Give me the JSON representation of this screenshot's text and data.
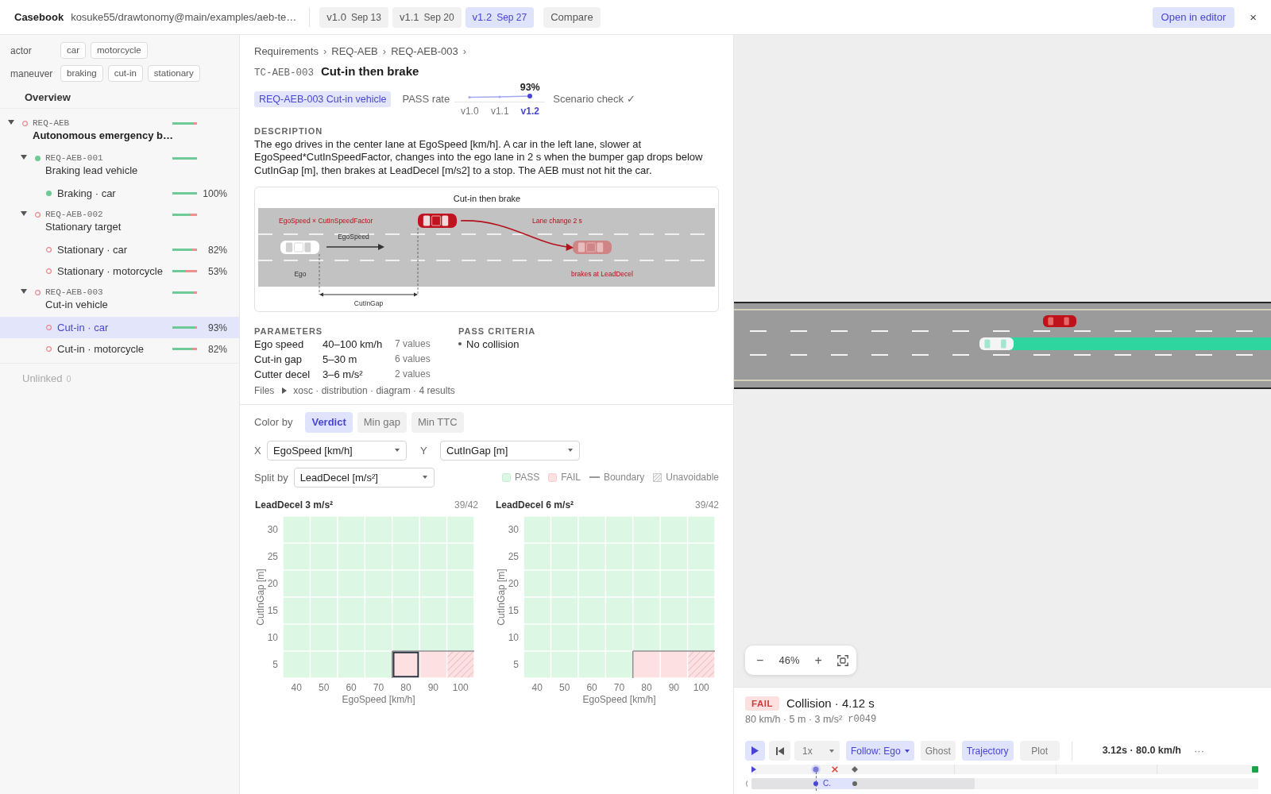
{
  "topbar": {
    "app_name": "Casebook",
    "path": "kosuke55/drawtonomy@main/examples/aeb-te…",
    "versions": [
      {
        "version": "v1.0",
        "date": "Sep 13",
        "selected": false
      },
      {
        "version": "v1.1",
        "date": "Sep 20",
        "selected": false
      },
      {
        "version": "v1.2",
        "date": "Sep 27",
        "selected": true
      }
    ],
    "compare": "Compare",
    "open_editor": "Open in editor",
    "close": "×"
  },
  "filters": [
    {
      "label": "actor",
      "chips": [
        "car",
        "motorcycle"
      ]
    },
    {
      "label": "maneuver",
      "chips": [
        "braking",
        "cut-in",
        "stationary"
      ]
    }
  ],
  "overview": "Overview",
  "tree": [
    {
      "id": "REQ-AEB",
      "title": "Autonomous emergency b…",
      "passed": false,
      "level": 0.88,
      "expanded": true,
      "selected": false,
      "children": [
        {
          "id": "REQ-AEB-001",
          "title": "Braking lead vehicle",
          "passed": true,
          "level": 1,
          "expanded": true,
          "selected": false,
          "children": [
            {
              "label": "Braking · car",
              "passed": true,
              "level": 1,
              "percent": "100%",
              "selected": false
            }
          ]
        },
        {
          "id": "REQ-AEB-002",
          "title": "Stationary target",
          "passed": false,
          "level": 0.7,
          "expanded": true,
          "selected": false,
          "children": [
            {
              "label": "Stationary · car",
              "passed": false,
              "level": 0.81,
              "percent": "82%",
              "selected": false
            },
            {
              "label": "Stationary · motorcycle",
              "passed": false,
              "level": 0.53,
              "percent": "53%",
              "selected": false
            }
          ]
        },
        {
          "id": "REQ-AEB-003",
          "title": "Cut-in vehicle",
          "passed": false,
          "level": 0.88,
          "expanded": true,
          "selected": false,
          "children": [
            {
              "label": "Cut-in · car",
              "passed": false,
              "level": 0.92,
              "percent": "93%",
              "selected": true
            },
            {
              "label": "Cut-in · motorcycle",
              "passed": false,
              "level": 0.81,
              "percent": "82%",
              "selected": false
            }
          ]
        }
      ]
    }
  ],
  "unlinked": {
    "label": "Unlinked",
    "count": "0"
  },
  "breadcrumb": [
    {
      "label": "Requirements",
      "separator": "›"
    },
    {
      "label": "REQ-AEB",
      "separator": "›"
    },
    {
      "label": "REQ-AEB-003",
      "separator": "›"
    }
  ],
  "case": {
    "id": "TC-AEB-003",
    "title": "Cut-in then brake"
  },
  "requirement_tag": "REQ-AEB-003 Cut-in vehicle",
  "pass_rate": {
    "label": "PASS rate",
    "value": "93%",
    "versions": [
      {
        "label": "v1.0",
        "selected": false
      },
      {
        "label": "v1.1",
        "selected": false
      },
      {
        "label": "v1.2",
        "selected": true
      }
    ]
  },
  "scenario_check": "Scenario check ✓",
  "description": {
    "heading": "DESCRIPTION",
    "text": "The ego drives in the center lane at EgoSpeed [km/h]. A car in the left lane, slower at EgoSpeed*CutInSpeedFactor, changes into the ego lane in 2 s when the bumper gap drops below CutInGap [m], then brakes at LeadDecel [m/s2] to a stop. The AEB must not hit the car."
  },
  "diagram": {
    "title": "Cut-in then brake",
    "labels": {
      "cutter_speed": "EgoSpeed × CutInSpeedFactor",
      "ego_speed": "EgoSpeed",
      "lane_change": "Lane change 2 s",
      "ego": "Ego",
      "brake": "brakes at LeadDecel",
      "gap": "CutInGap"
    }
  },
  "parameters": {
    "heading": "PARAMETERS",
    "rows": [
      {
        "name": "Ego speed",
        "range": "40–100 km/h",
        "count": "7 values"
      },
      {
        "name": "Cut-in gap",
        "range": "5–30 m",
        "count": "6 values"
      },
      {
        "name": "Cutter decel",
        "range": "3–6 m/s²",
        "count": "2 values"
      }
    ]
  },
  "pass_criteria": {
    "heading": "PASS CRITERIA",
    "items": [
      "No collision"
    ]
  },
  "files": {
    "label": "Files",
    "expanded": false,
    "summary": "xosc · distribution · diagram · 4 results"
  },
  "color_by": {
    "label": "Color by",
    "options": [
      {
        "label": "Verdict",
        "selected": true
      },
      {
        "label": "Min gap",
        "selected": false
      },
      {
        "label": "Min TTC",
        "selected": false
      }
    ]
  },
  "axes": {
    "x": {
      "label": "X",
      "value": "EgoSpeed [km/h]"
    },
    "y": {
      "label": "Y",
      "value": "CutInGap [m]"
    },
    "split": {
      "label": "Split by",
      "value": "LeadDecel [m/s²]"
    }
  },
  "legend": [
    {
      "kind": "pass",
      "label": "PASS"
    },
    {
      "kind": "fail",
      "label": "FAIL"
    },
    {
      "kind": "boundary",
      "label": "Boundary"
    },
    {
      "kind": "unavoidable",
      "label": "Unavoidable"
    }
  ],
  "panels": [
    {
      "title": "LeadDecel 3 m/s²",
      "count": "39/42",
      "y_label": "CutInGap [m]",
      "x_label": "EgoSpeed [km/h]",
      "x_ticks": [
        "40",
        "50",
        "60",
        "70",
        "80",
        "90",
        "100"
      ],
      "rows": [
        {
          "tick": "30",
          "cells": [
            {
              "kind": "pass",
              "selected": false
            },
            {
              "kind": "pass",
              "selected": false
            },
            {
              "kind": "pass",
              "selected": false
            },
            {
              "kind": "pass",
              "selected": false
            },
            {
              "kind": "pass",
              "selected": false
            },
            {
              "kind": "pass",
              "selected": false
            },
            {
              "kind": "pass",
              "selected": false
            }
          ]
        },
        {
          "tick": "25",
          "cells": [
            {
              "kind": "pass",
              "selected": false
            },
            {
              "kind": "pass",
              "selected": false
            },
            {
              "kind": "pass",
              "selected": false
            },
            {
              "kind": "pass",
              "selected": false
            },
            {
              "kind": "pass",
              "selected": false
            },
            {
              "kind": "pass",
              "selected": false
            },
            {
              "kind": "pass",
              "selected": false
            }
          ]
        },
        {
          "tick": "20",
          "cells": [
            {
              "kind": "pass",
              "selected": false
            },
            {
              "kind": "pass",
              "selected": false
            },
            {
              "kind": "pass",
              "selected": false
            },
            {
              "kind": "pass",
              "selected": false
            },
            {
              "kind": "pass",
              "selected": false
            },
            {
              "kind": "pass",
              "selected": false
            },
            {
              "kind": "pass",
              "selected": false
            }
          ]
        },
        {
          "tick": "15",
          "cells": [
            {
              "kind": "pass",
              "selected": false
            },
            {
              "kind": "pass",
              "selected": false
            },
            {
              "kind": "pass",
              "selected": false
            },
            {
              "kind": "pass",
              "selected": false
            },
            {
              "kind": "pass",
              "selected": false
            },
            {
              "kind": "pass",
              "selected": false
            },
            {
              "kind": "pass",
              "selected": false
            }
          ]
        },
        {
          "tick": "10",
          "cells": [
            {
              "kind": "pass",
              "selected": false
            },
            {
              "kind": "pass",
              "selected": false
            },
            {
              "kind": "pass",
              "selected": false
            },
            {
              "kind": "pass",
              "selected": false
            },
            {
              "kind": "pass",
              "selected": false
            },
            {
              "kind": "pass",
              "selected": false
            },
            {
              "kind": "pass",
              "selected": false
            }
          ]
        },
        {
          "tick": "5",
          "cells": [
            {
              "kind": "pass",
              "selected": false
            },
            {
              "kind": "pass",
              "selected": false
            },
            {
              "kind": "pass",
              "selected": false
            },
            {
              "kind": "pass",
              "selected": false
            },
            {
              "kind": "fail",
              "selected": true
            },
            {
              "kind": "fail",
              "selected": false
            },
            {
              "kind": "unavoidable",
              "selected": false
            }
          ]
        }
      ]
    },
    {
      "title": "LeadDecel 6 m/s²",
      "count": "39/42",
      "y_label": "CutInGap [m]",
      "x_label": "EgoSpeed [km/h]",
      "x_ticks": [
        "40",
        "50",
        "60",
        "70",
        "80",
        "90",
        "100"
      ],
      "rows": [
        {
          "tick": "30",
          "cells": [
            {
              "kind": "pass",
              "selected": false
            },
            {
              "kind": "pass",
              "selected": false
            },
            {
              "kind": "pass",
              "selected": false
            },
            {
              "kind": "pass",
              "selected": false
            },
            {
              "kind": "pass",
              "selected": false
            },
            {
              "kind": "pass",
              "selected": false
            },
            {
              "kind": "pass",
              "selected": false
            }
          ]
        },
        {
          "tick": "25",
          "cells": [
            {
              "kind": "pass",
              "selected": false
            },
            {
              "kind": "pass",
              "selected": false
            },
            {
              "kind": "pass",
              "selected": false
            },
            {
              "kind": "pass",
              "selected": false
            },
            {
              "kind": "pass",
              "selected": false
            },
            {
              "kind": "pass",
              "selected": false
            },
            {
              "kind": "pass",
              "selected": false
            }
          ]
        },
        {
          "tick": "20",
          "cells": [
            {
              "kind": "pass",
              "selected": false
            },
            {
              "kind": "pass",
              "selected": false
            },
            {
              "kind": "pass",
              "selected": false
            },
            {
              "kind": "pass",
              "selected": false
            },
            {
              "kind": "pass",
              "selected": false
            },
            {
              "kind": "pass",
              "selected": false
            },
            {
              "kind": "pass",
              "selected": false
            }
          ]
        },
        {
          "tick": "15",
          "cells": [
            {
              "kind": "pass",
              "selected": false
            },
            {
              "kind": "pass",
              "selected": false
            },
            {
              "kind": "pass",
              "selected": false
            },
            {
              "kind": "pass",
              "selected": false
            },
            {
              "kind": "pass",
              "selected": false
            },
            {
              "kind": "pass",
              "selected": false
            },
            {
              "kind": "pass",
              "selected": false
            }
          ]
        },
        {
          "tick": "10",
          "cells": [
            {
              "kind": "pass",
              "selected": false
            },
            {
              "kind": "pass",
              "selected": false
            },
            {
              "kind": "pass",
              "selected": false
            },
            {
              "kind": "pass",
              "selected": false
            },
            {
              "kind": "pass",
              "selected": false
            },
            {
              "kind": "pass",
              "selected": false
            },
            {
              "kind": "pass",
              "selected": false
            }
          ]
        },
        {
          "tick": "5",
          "cells": [
            {
              "kind": "pass",
              "selected": false
            },
            {
              "kind": "pass",
              "selected": false
            },
            {
              "kind": "pass",
              "selected": false
            },
            {
              "kind": "pass",
              "selected": false
            },
            {
              "kind": "fail",
              "selected": false
            },
            {
              "kind": "fail",
              "selected": false
            },
            {
              "kind": "unavoidable",
              "selected": false
            }
          ]
        }
      ]
    }
  ],
  "viewer": {
    "zoom": {
      "minus": "−",
      "value": "46%",
      "plus": "+"
    },
    "result": {
      "verdict": "FAIL",
      "passed": false,
      "title": "Collision · 4.12 s",
      "params": "80 km/h · 5 m · 3 m/s²",
      "run": "r0049"
    },
    "controls": {
      "speed": "1x",
      "follow": "Follow: Ego",
      "toggles": [
        {
          "label": "Ghost",
          "kind": "ghost",
          "on": false
        },
        {
          "label": "Trajectory",
          "kind": "trajectory",
          "on": true
        },
        {
          "label": "Plot",
          "kind": "plot",
          "on": false
        }
      ],
      "readout": "3.12s · 80.0 km/h",
      "more": "···"
    },
    "timeline": {
      "level": 0.12,
      "markers": [
        {
          "kind": "start",
          "level": 0
        },
        {
          "kind": "collision",
          "level": 0.16
        },
        {
          "kind": "event",
          "level": 0.2
        },
        {
          "kind": "end",
          "level": 1
        }
      ],
      "lane": {
        "label": "C.",
        "level": 0.44
      }
    }
  }
}
